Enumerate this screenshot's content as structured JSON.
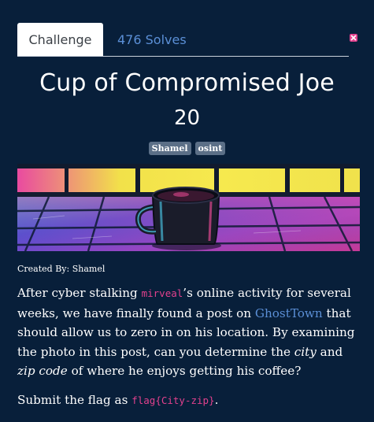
{
  "tabs": {
    "challenge_label": "Challenge",
    "solves_label": "476 Solves"
  },
  "challenge": {
    "title": "Cup of Compromised Joe",
    "value": "20",
    "tags": [
      "Shamel",
      "osint"
    ],
    "created_by": "Created By: Shamel",
    "description": {
      "part1": "After cyber stalking ",
      "username": "mirveal",
      "part2": "’s online activity for several weeks, we have finally found a post on ",
      "link_text": "GhostTown",
      "part3": " that should allow us to zero in on his location. By examining the photo in this post, can you determine the ",
      "em1": "city",
      "part4": " and ",
      "em2": "zip code",
      "part5": " of where he enjoys getting his coffee?"
    },
    "submit": {
      "prefix": "Submit the flag as ",
      "flag_format": "flag{City-zip}",
      "suffix": "."
    }
  },
  "colors": {
    "background": "#081f3a",
    "link": "#5b8fd6",
    "code": "#e2418d",
    "tag": "#5b6f87",
    "close": "#e2418d"
  },
  "icons": {
    "close": "close-icon"
  }
}
